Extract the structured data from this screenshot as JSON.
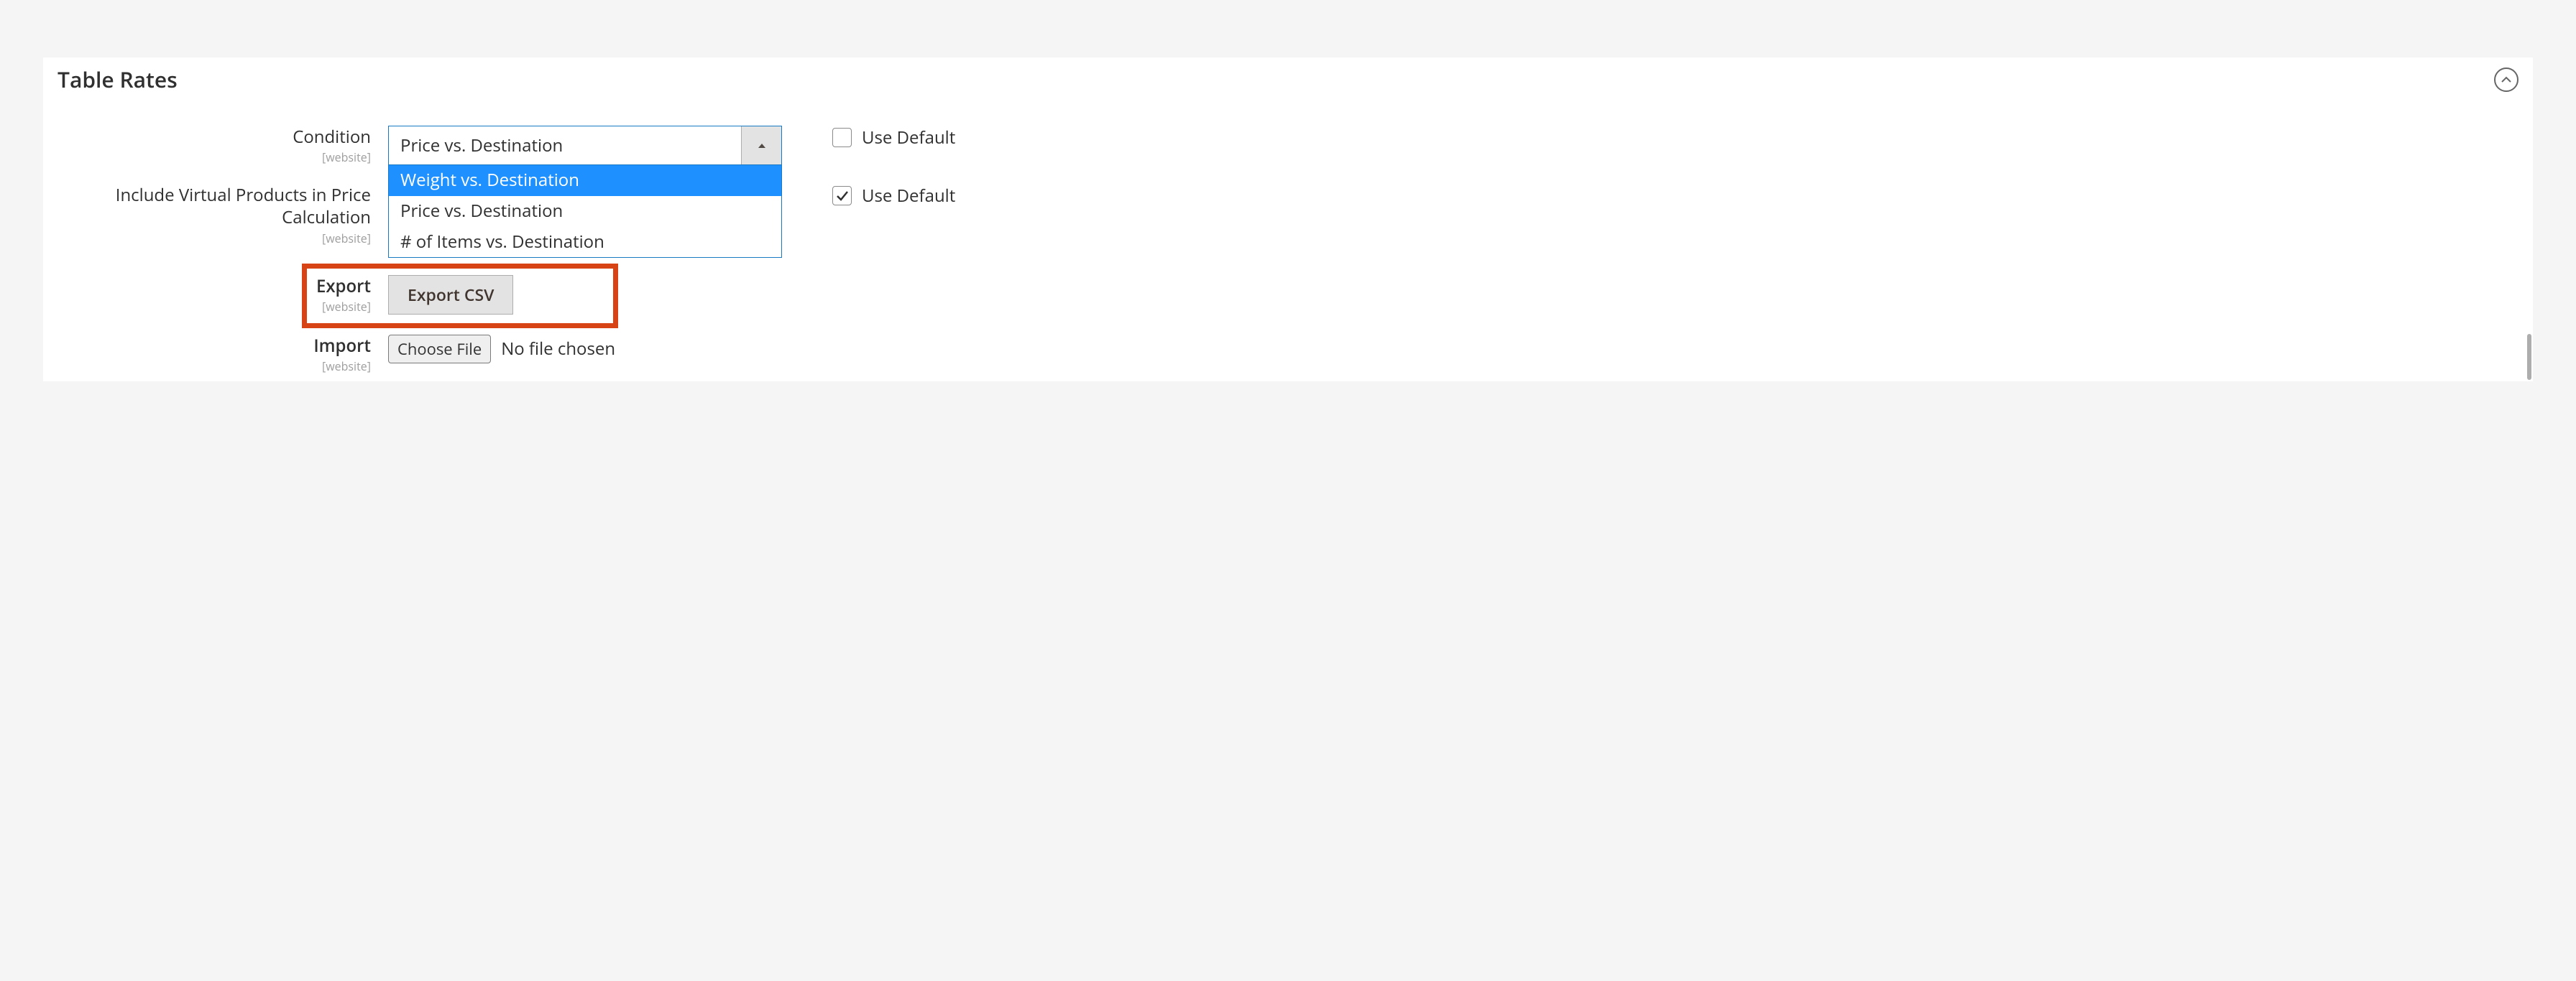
{
  "panel": {
    "title": "Table Rates"
  },
  "labels": {
    "condition": "Condition",
    "includeVirtual_line1": "Include Virtual Products in Price",
    "includeVirtual_line2": "Calculation",
    "export": "Export",
    "import": "Import",
    "scope": "[website]",
    "useDefault": "Use Default"
  },
  "condition": {
    "selected": "Price vs. Destination",
    "options": [
      "Weight vs. Destination",
      "Price vs. Destination",
      "# of Items vs. Destination"
    ],
    "highlightedIndex": 0,
    "useDefaultChecked": false
  },
  "includeVirtual": {
    "useDefaultChecked": true
  },
  "export": {
    "buttonLabel": "Export CSV"
  },
  "import": {
    "chooseFileLabel": "Choose File",
    "status": "No file chosen"
  }
}
